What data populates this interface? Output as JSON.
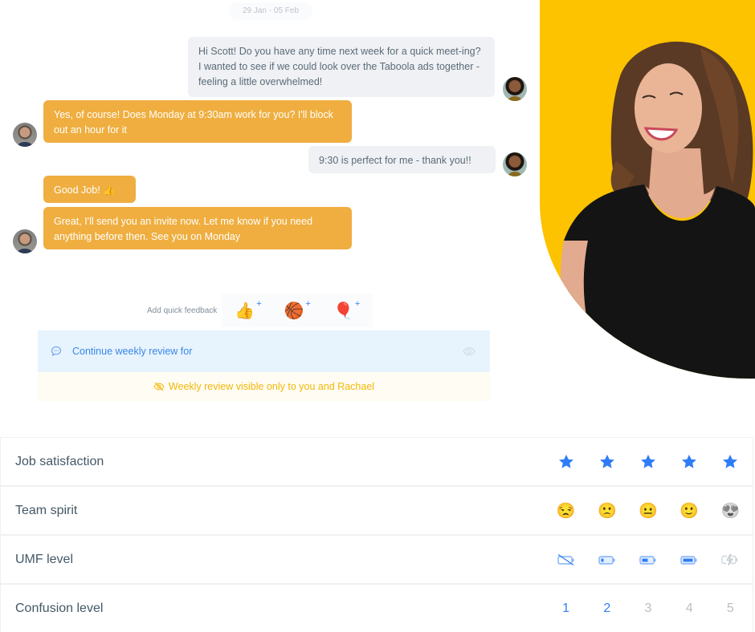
{
  "chat": {
    "date_range": "29 Jan - 05 Feb",
    "messages": [
      {
        "sender": "Rachael",
        "side": "right",
        "style": "grey",
        "text": "Hi Scott! Do you have any time next week for a quick meet-ing? I wanted to see if we could look over the Taboola ads together - feeling a little overwhelmed!"
      },
      {
        "sender": "Scott",
        "side": "left",
        "style": "orange",
        "text": "Yes, of course! Does Monday at 9:30am work for you? I'll block out an hour for it"
      },
      {
        "sender": "Rachael",
        "side": "right",
        "style": "grey",
        "text": "9:30 is perfect for me - thank you!!"
      },
      {
        "sender": "Scott",
        "side": "left",
        "style": "orange",
        "text": "Good Job! 👍"
      },
      {
        "sender": "Scott",
        "side": "left",
        "style": "orange",
        "text": "Great, I'll send you an invite now. Let me know if you need anything before then. See you on Monday"
      }
    ]
  },
  "quick_feedback": {
    "label": "Add quick feedback",
    "items": [
      {
        "icon": "thumbs-up-icon",
        "glyph": "👍",
        "plus": "+"
      },
      {
        "icon": "basketball-icon",
        "glyph": "🏀",
        "plus": "+"
      },
      {
        "icon": "balloon-icon",
        "glyph": "🎈",
        "plus": "+"
      }
    ]
  },
  "weekly_review": {
    "continue_text": "Continue weekly review for",
    "visibility_text": "Weekly review visible only to you and Rachael"
  },
  "ratings": [
    {
      "label": "Job satisfaction",
      "type": "stars",
      "value": 5,
      "max": 5
    },
    {
      "label": "Team spirit",
      "type": "emoji",
      "options": [
        "😒",
        "🙁",
        "😐",
        "🙂",
        "😍"
      ],
      "selected": 4
    },
    {
      "label": "UMF level",
      "type": "battery",
      "options": [
        "battery-empty-icon",
        "battery-low-icon",
        "battery-half-icon",
        "battery-full-icon",
        "battery-charging-icon"
      ],
      "selected": 4
    },
    {
      "label": "Confusion level",
      "type": "numbers",
      "options": [
        "1",
        "2",
        "3",
        "4",
        "5"
      ],
      "selected": 2
    }
  ],
  "colors": {
    "accent_blue": "#2f7df6",
    "bubble_orange": "#efae3f",
    "hero_yellow": "#fdc200",
    "visibility_yellow": "#f2b808"
  }
}
